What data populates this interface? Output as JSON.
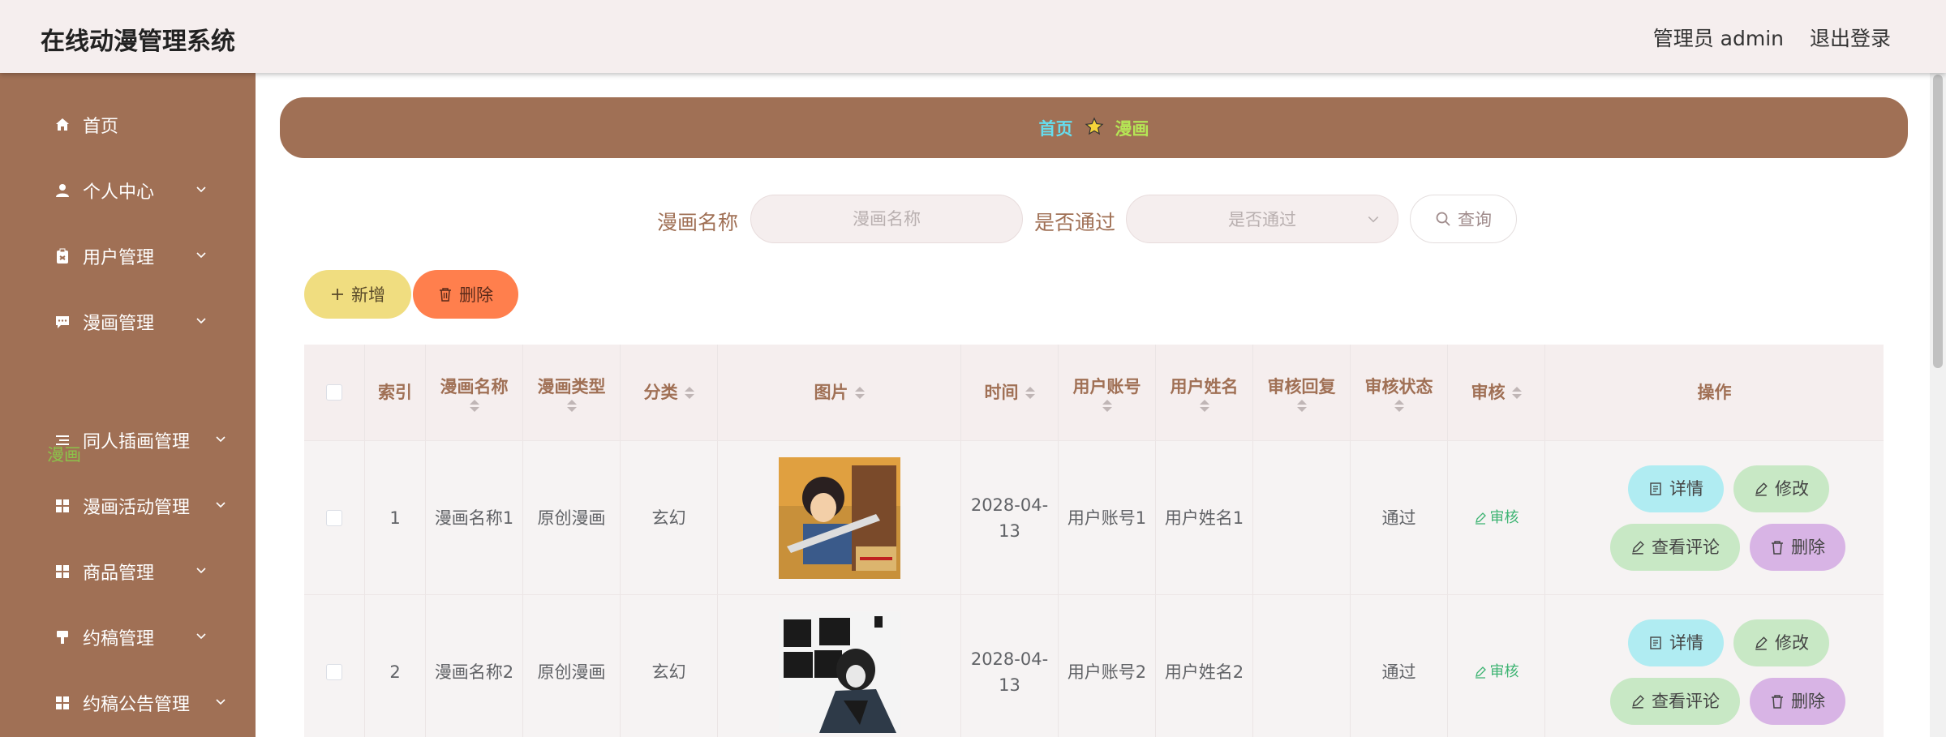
{
  "header": {
    "title": "在线动漫管理系统",
    "user": "管理员 admin",
    "logout": "退出登录"
  },
  "sidebar": {
    "items": [
      {
        "label": "首页",
        "icon": "home-icon"
      },
      {
        "label": "个人中心",
        "icon": "user-icon"
      },
      {
        "label": "用户管理",
        "icon": "clipboard-icon"
      },
      {
        "label": "漫画管理",
        "icon": "chat-icon"
      },
      {
        "label": "同人插画管理",
        "icon": "list-icon"
      },
      {
        "label": "漫画活动管理",
        "icon": "grid-icon"
      },
      {
        "label": "商品管理",
        "icon": "grid-icon"
      },
      {
        "label": "约稿管理",
        "icon": "brush-icon"
      },
      {
        "label": "约稿公告管理",
        "icon": "grid-icon"
      }
    ],
    "active_sub": "漫画"
  },
  "breadcrumb": {
    "home": "首页",
    "current": "漫画"
  },
  "search": {
    "name_label": "漫画名称",
    "name_placeholder": "漫画名称",
    "pass_label": "是否通过",
    "pass_placeholder": "是否通过",
    "query": "查询"
  },
  "actions": {
    "add": "新增",
    "delete": "删除"
  },
  "table": {
    "headers": [
      "索引",
      "漫画名称",
      "漫画类型",
      "分类",
      "图片",
      "时间",
      "用户账号",
      "用户姓名",
      "审核回复",
      "审核状态",
      "审核",
      "操作"
    ],
    "rows": [
      {
        "index": "1",
        "name": "漫画名称1",
        "type": "原创漫画",
        "category": "玄幻",
        "time": "2028-04-13",
        "account": "用户账号1",
        "username": "用户姓名1",
        "reply": "",
        "status": "通过",
        "audit": "审核"
      },
      {
        "index": "2",
        "name": "漫画名称2",
        "type": "原创漫画",
        "category": "玄幻",
        "time": "2028-04-13",
        "account": "用户账号2",
        "username": "用户姓名2",
        "reply": "",
        "status": "通过",
        "audit": "审核"
      }
    ],
    "ops": {
      "detail": "详情",
      "edit": "修改",
      "comment": "查看评论",
      "delete": "删除"
    }
  },
  "colors": {
    "brown": "#a07055",
    "header_bg": "#f5eeee",
    "accent_green": "#8bc34a",
    "cyan": "#66ddee"
  }
}
